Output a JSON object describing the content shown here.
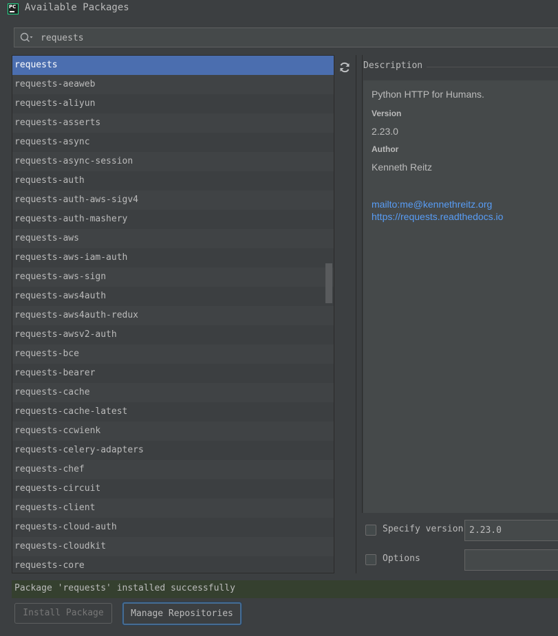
{
  "window": {
    "title": "Available Packages",
    "icon": "pycharm-icon"
  },
  "search": {
    "value": "requests",
    "icon": "search-icon"
  },
  "packages": [
    "requests",
    "requests-aeaweb",
    "requests-aliyun",
    "requests-asserts",
    "requests-async",
    "requests-async-session",
    "requests-auth",
    "requests-auth-aws-sigv4",
    "requests-auth-mashery",
    "requests-aws",
    "requests-aws-iam-auth",
    "requests-aws-sign",
    "requests-aws4auth",
    "requests-aws4auth-redux",
    "requests-awsv2-auth",
    "requests-bce",
    "requests-bearer",
    "requests-cache",
    "requests-cache-latest",
    "requests-ccwienk",
    "requests-celery-adapters",
    "requests-chef",
    "requests-circuit",
    "requests-client",
    "requests-cloud-auth",
    "requests-cloudkit",
    "requests-core"
  ],
  "selected_package": "requests",
  "toolbar": {
    "refresh_icon": "refresh-icon"
  },
  "description": {
    "title": "Description",
    "summary": "Python HTTP for Humans.",
    "version_label": "Version",
    "version": "2.23.0",
    "author_label": "Author",
    "author": "Kenneth Reitz",
    "links": [
      "mailto:me@kennethreitz.org",
      "https://requests.readthedocs.io"
    ]
  },
  "options": {
    "specify_version_label": "Specify version",
    "specify_version_value": "2.23.0",
    "options_label": "Options",
    "options_value": ""
  },
  "status": {
    "message": "Package 'requests' installed successfully"
  },
  "buttons": {
    "install": "Install Package",
    "manage": "Manage Repositories"
  },
  "colors": {
    "background": "#3c3f41",
    "selection": "#4b6eaf",
    "link": "#589df6",
    "status_bg": "#35402f"
  }
}
